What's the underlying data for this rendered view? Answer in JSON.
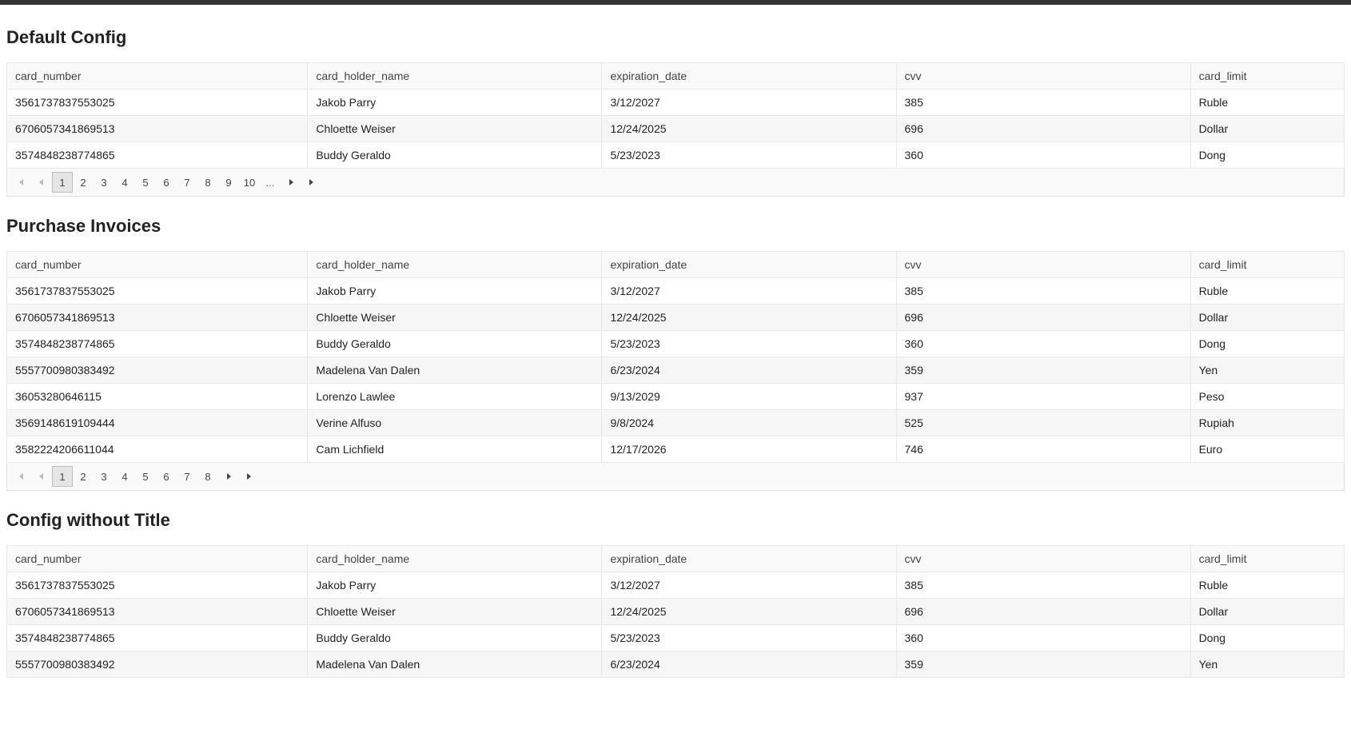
{
  "columns": [
    "card_number",
    "card_holder_name",
    "expiration_date",
    "cvv",
    "card_limit"
  ],
  "sections": [
    {
      "title": "Default Config",
      "rows": [
        {
          "card_number": "3561737837553025",
          "card_holder_name": "Jakob Parry",
          "expiration_date": "3/12/2027",
          "cvv": "385",
          "card_limit": "Ruble"
        },
        {
          "card_number": "6706057341869513",
          "card_holder_name": "Chloette Weiser",
          "expiration_date": "12/24/2025",
          "cvv": "696",
          "card_limit": "Dollar"
        },
        {
          "card_number": "3574848238774865",
          "card_holder_name": "Buddy Geraldo",
          "expiration_date": "5/23/2023",
          "cvv": "360",
          "card_limit": "Dong"
        }
      ],
      "pager": {
        "pages": [
          "1",
          "2",
          "3",
          "4",
          "5",
          "6",
          "7",
          "8",
          "9",
          "10"
        ],
        "ellipsis": "...",
        "active": "1"
      }
    },
    {
      "title": "Purchase Invoices",
      "rows": [
        {
          "card_number": "3561737837553025",
          "card_holder_name": "Jakob Parry",
          "expiration_date": "3/12/2027",
          "cvv": "385",
          "card_limit": "Ruble"
        },
        {
          "card_number": "6706057341869513",
          "card_holder_name": "Chloette Weiser",
          "expiration_date": "12/24/2025",
          "cvv": "696",
          "card_limit": "Dollar"
        },
        {
          "card_number": "3574848238774865",
          "card_holder_name": "Buddy Geraldo",
          "expiration_date": "5/23/2023",
          "cvv": "360",
          "card_limit": "Dong"
        },
        {
          "card_number": "5557700980383492",
          "card_holder_name": "Madelena Van Dalen",
          "expiration_date": "6/23/2024",
          "cvv": "359",
          "card_limit": "Yen"
        },
        {
          "card_number": "36053280646115",
          "card_holder_name": "Lorenzo Lawlee",
          "expiration_date": "9/13/2029",
          "cvv": "937",
          "card_limit": "Peso"
        },
        {
          "card_number": "3569148619109444",
          "card_holder_name": "Verine Alfuso",
          "expiration_date": "9/8/2024",
          "cvv": "525",
          "card_limit": "Rupiah"
        },
        {
          "card_number": "3582224206611044",
          "card_holder_name": "Cam Lichfield",
          "expiration_date": "12/17/2026",
          "cvv": "746",
          "card_limit": "Euro"
        }
      ],
      "pager": {
        "pages": [
          "1",
          "2",
          "3",
          "4",
          "5",
          "6",
          "7",
          "8"
        ],
        "ellipsis": null,
        "active": "1"
      }
    },
    {
      "title": "Config without Title",
      "rows": [
        {
          "card_number": "3561737837553025",
          "card_holder_name": "Jakob Parry",
          "expiration_date": "3/12/2027",
          "cvv": "385",
          "card_limit": "Ruble"
        },
        {
          "card_number": "6706057341869513",
          "card_holder_name": "Chloette Weiser",
          "expiration_date": "12/24/2025",
          "cvv": "696",
          "card_limit": "Dollar"
        },
        {
          "card_number": "3574848238774865",
          "card_holder_name": "Buddy Geraldo",
          "expiration_date": "5/23/2023",
          "cvv": "360",
          "card_limit": "Dong"
        },
        {
          "card_number": "5557700980383492",
          "card_holder_name": "Madelena Van Dalen",
          "expiration_date": "6/23/2024",
          "cvv": "359",
          "card_limit": "Yen"
        }
      ],
      "pager": null
    }
  ]
}
